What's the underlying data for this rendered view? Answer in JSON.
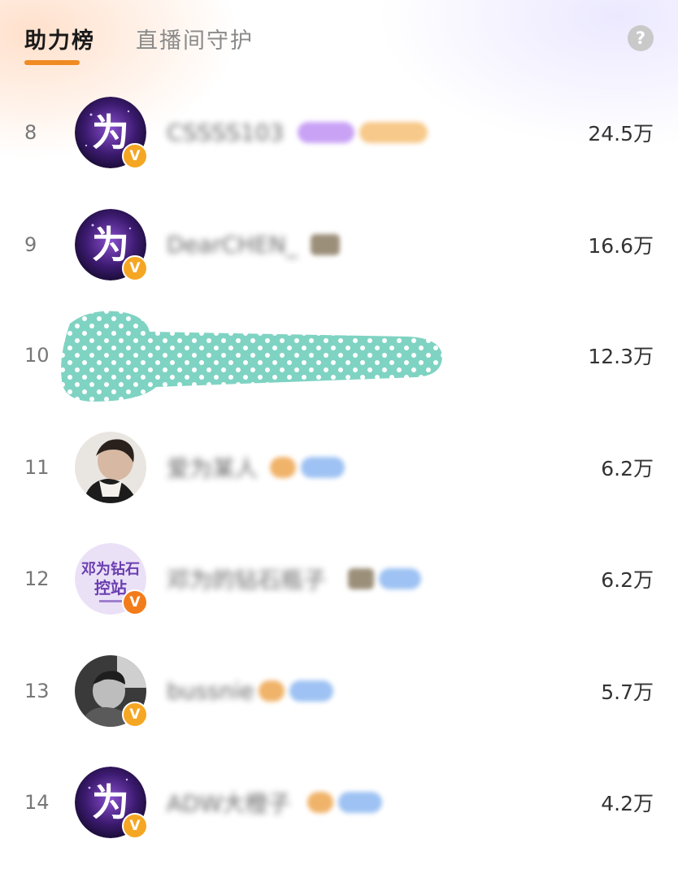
{
  "tabs": [
    {
      "label": "助力榜",
      "active": true
    },
    {
      "label": "直播间守护",
      "active": false
    }
  ],
  "help_icon": "?",
  "accent_color": "#f08a22",
  "verified_mark": "V",
  "rows": [
    {
      "rank": "8",
      "name": "CSSSS103",
      "score": "24.5万",
      "avatar": "purple-logo",
      "avatar_text": "为"
    },
    {
      "rank": "9",
      "name": "DearCHEN_",
      "score": "16.6万",
      "avatar": "purple-logo",
      "avatar_text": "为"
    },
    {
      "rank": "10",
      "name": "",
      "score": "12.3万",
      "avatar": "censored"
    },
    {
      "rank": "11",
      "name": "爱为某人",
      "score": "6.2万",
      "avatar": "photo"
    },
    {
      "rank": "12",
      "name": "邓为的钻石瓶子",
      "score": "6.2万",
      "avatar": "fan-club",
      "avatar_text_line1": "邓为钻石",
      "avatar_text_line2": "控站"
    },
    {
      "rank": "13",
      "name": "bussnie",
      "score": "5.7万",
      "avatar": "photo-bw"
    },
    {
      "rank": "14",
      "name": "ADW大橙子",
      "score": "4.2万",
      "avatar": "purple-logo",
      "avatar_text": "为"
    }
  ]
}
